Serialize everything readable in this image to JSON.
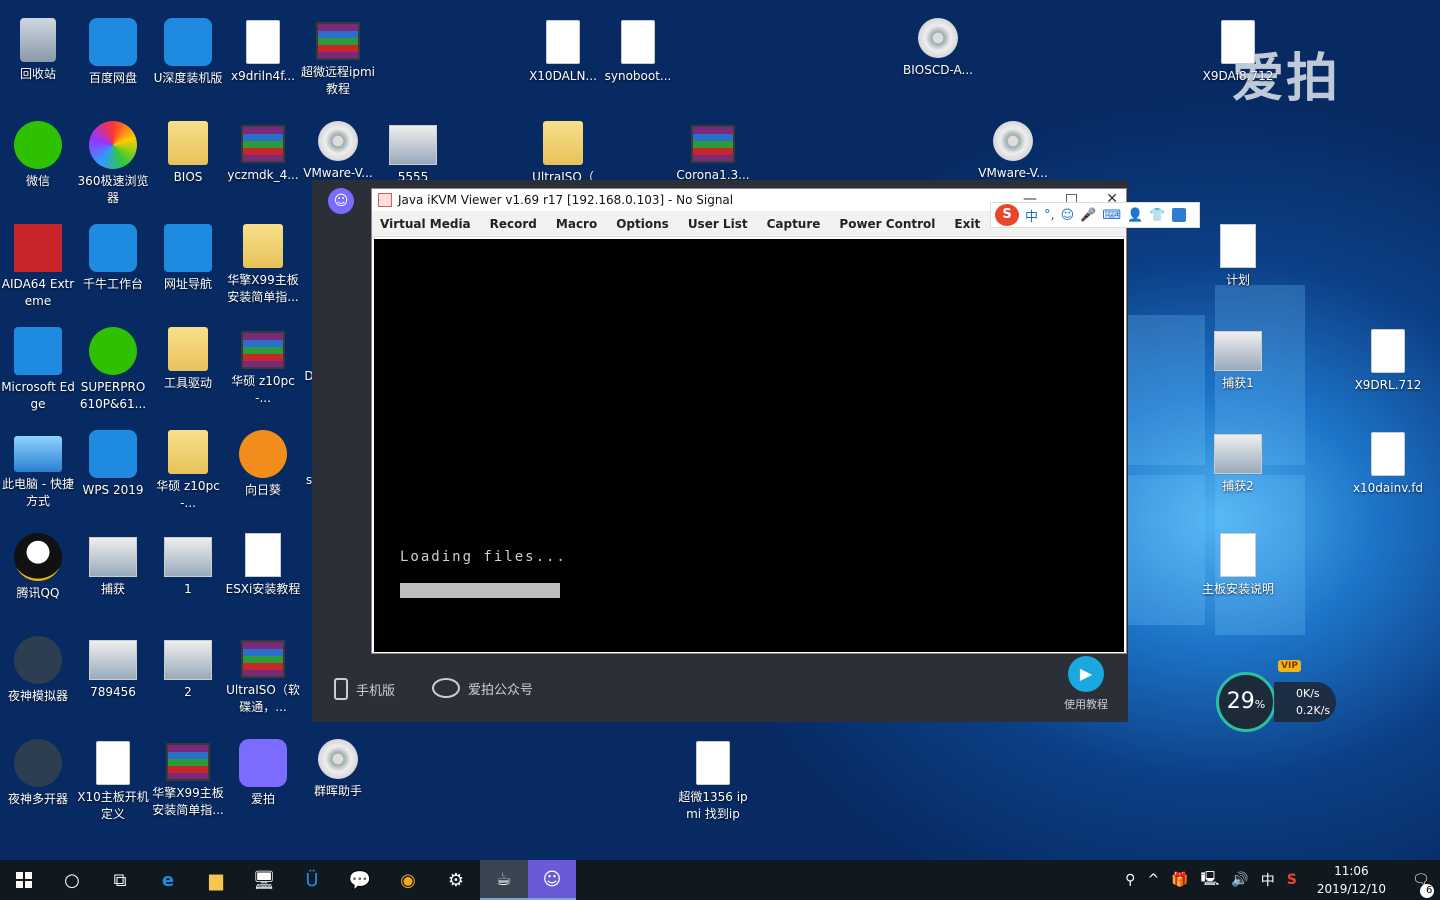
{
  "desktop": {
    "icons": [
      {
        "label": "回收站"
      },
      {
        "label": "百度网盘"
      },
      {
        "label": "U深度装机版"
      },
      {
        "label": "x9driln4f..."
      },
      {
        "label": "超微远程ipmi教程"
      },
      {
        "label": "X10DALN..."
      },
      {
        "label": "synoboot..."
      },
      {
        "label": "BIOSCD-A..."
      },
      {
        "label": "X9DAi8.712"
      },
      {
        "label": "微信"
      },
      {
        "label": "360极速浏览器"
      },
      {
        "label": "BIOS"
      },
      {
        "label": "yczmdk_4..."
      },
      {
        "label": "VMware-V..."
      },
      {
        "label": "5555"
      },
      {
        "label": "UltraISO（"
      },
      {
        "label": "Corona1.3..."
      },
      {
        "label": "VMware-V..."
      },
      {
        "label": "AIDA64 Extreme"
      },
      {
        "label": "千牛工作台"
      },
      {
        "label": "网址导航"
      },
      {
        "label": "华擎X99主板安装简单指..."
      },
      {
        "label": "计划"
      },
      {
        "label": "Microsoft Edge"
      },
      {
        "label": "SUPERPRO 610P&61..."
      },
      {
        "label": "工具驱动"
      },
      {
        "label": "华硕 z10pc-..."
      },
      {
        "label": "捕获1"
      },
      {
        "label": "X9DRL.712"
      },
      {
        "label": "此电脑 - 快捷方式"
      },
      {
        "label": "WPS 2019"
      },
      {
        "label": "华硕 z10pc-..."
      },
      {
        "label": "向日葵"
      },
      {
        "label": "捕获2"
      },
      {
        "label": "x10dainv.fd"
      },
      {
        "label": "腾讯QQ"
      },
      {
        "label": "捕获"
      },
      {
        "label": "1"
      },
      {
        "label": "ESXi安装教程"
      },
      {
        "label": "主板安装说明"
      },
      {
        "label": "夜神模拟器"
      },
      {
        "label": "789456"
      },
      {
        "label": "2"
      },
      {
        "label": "UltraISO（软碟通，..."
      },
      {
        "label": "夜神多开器"
      },
      {
        "label": "X10主板开机定义"
      },
      {
        "label": "华擎X99主板安装简单指..."
      },
      {
        "label": "爱拍"
      },
      {
        "label": "群晖助手"
      },
      {
        "label": "超微1356 ipmi 找到ip"
      }
    ],
    "partial_labels": [
      "D",
      "s"
    ],
    "watermark": "爱拍"
  },
  "aipai": {
    "bottom": {
      "mobile": "手机版",
      "wechat": "爱拍公众号",
      "tutorial": "使用教程"
    }
  },
  "java_window": {
    "title": "Java iKVM Viewer v1.69 r17 [192.168.0.103]  - No Signal",
    "menu": [
      "Virtual Media",
      "Record",
      "Macro",
      "Options",
      "User List",
      "Capture",
      "Power Control",
      "Exit"
    ],
    "screen": {
      "loading_text": "Loading files...",
      "progress_percent": 100
    }
  },
  "ime": {
    "lang": "中"
  },
  "net_widget": {
    "percent": "29",
    "percent_unit": "%",
    "up": "0K/s",
    "down": "0.2K/s",
    "vip": "VIP"
  },
  "taskbar": {
    "time": "11:06",
    "date": "2019/12/10",
    "ime_lang": "中",
    "notification_count": "6"
  },
  "colors": {
    "accent": "#1aa8e0",
    "taskbar": "#101820"
  }
}
